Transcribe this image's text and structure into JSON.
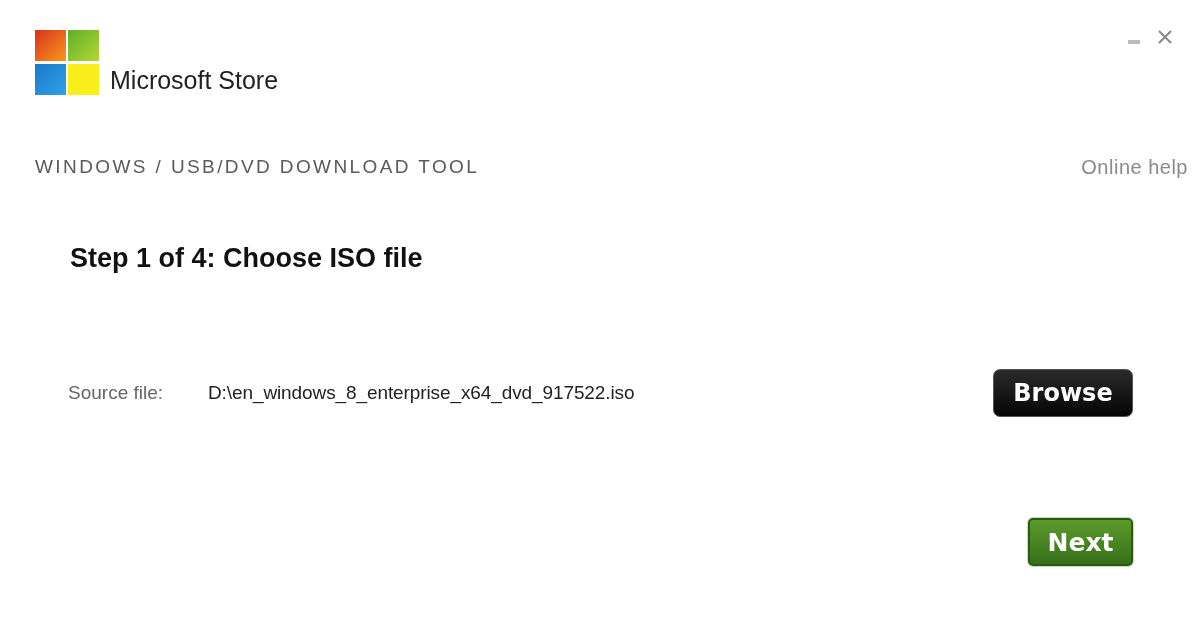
{
  "window": {
    "brand": "Microsoft Store",
    "controls": [
      {
        "kind": "minimize"
      },
      {
        "kind": "close"
      }
    ]
  },
  "toolbar": {
    "title": "WINDOWS / USB/DVD DOWNLOAD TOOL",
    "help_link": "Online help"
  },
  "step": {
    "title": "Step 1 of 4: Choose ISO file",
    "source_label": "Source file:",
    "source_value": "D:\\en_windows_8_enterprise_x64_dvd_917522.iso",
    "browse_button": "Browse"
  },
  "buttons": [
    {
      "label": "Next"
    }
  ]
}
